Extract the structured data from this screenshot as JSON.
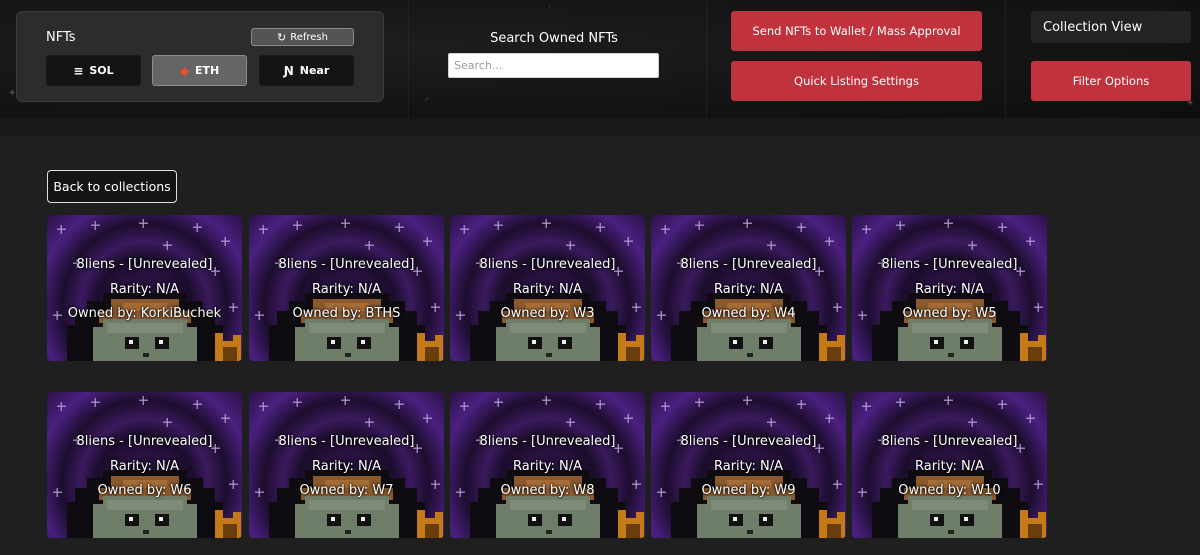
{
  "panel": {
    "title": "NFTs",
    "refresh_label": "Refresh",
    "chains": [
      {
        "label": "SOL",
        "icon": "solana-icon",
        "active": false
      },
      {
        "label": "ETH",
        "icon": "ethereum-icon",
        "active": true
      },
      {
        "label": "Near",
        "icon": "near-icon",
        "active": false
      }
    ]
  },
  "search": {
    "label": "Search Owned NFTs",
    "placeholder": "Search..."
  },
  "actions": {
    "send_label": "Send NFTs to Wallet / Mass Approval",
    "quick_listing_label": "Quick Listing Settings",
    "collection_view_label": "Collection View",
    "filter_label": "Filter Options"
  },
  "back_label": "Back to collections",
  "colors": {
    "accent_red": "#c0333c",
    "active_chain": "#656565",
    "background": "#1f1f1f"
  },
  "cards": [
    {
      "name": "8liens - [Unrevealed]",
      "rarity": "Rarity: N/A",
      "owner": "Owned by: KorkiBuchek"
    },
    {
      "name": "8liens - [Unrevealed]",
      "rarity": "Rarity: N/A",
      "owner": "Owned by: BTHS"
    },
    {
      "name": "8liens - [Unrevealed]",
      "rarity": "Rarity: N/A",
      "owner": "Owned by: W3"
    },
    {
      "name": "8liens - [Unrevealed]",
      "rarity": "Rarity: N/A",
      "owner": "Owned by: W4"
    },
    {
      "name": "8liens - [Unrevealed]",
      "rarity": "Rarity: N/A",
      "owner": "Owned by: W5"
    },
    {
      "name": "8liens - [Unrevealed]",
      "rarity": "Rarity: N/A",
      "owner": "Owned by: W6"
    },
    {
      "name": "8liens - [Unrevealed]",
      "rarity": "Rarity: N/A",
      "owner": "Owned by: W7"
    },
    {
      "name": "8liens - [Unrevealed]",
      "rarity": "Rarity: N/A",
      "owner": "Owned by: W8"
    },
    {
      "name": "8liens - [Unrevealed]",
      "rarity": "Rarity: N/A",
      "owner": "Owned by: W9"
    },
    {
      "name": "8liens - [Unrevealed]",
      "rarity": "Rarity: N/A",
      "owner": "Owned by: W10"
    }
  ]
}
